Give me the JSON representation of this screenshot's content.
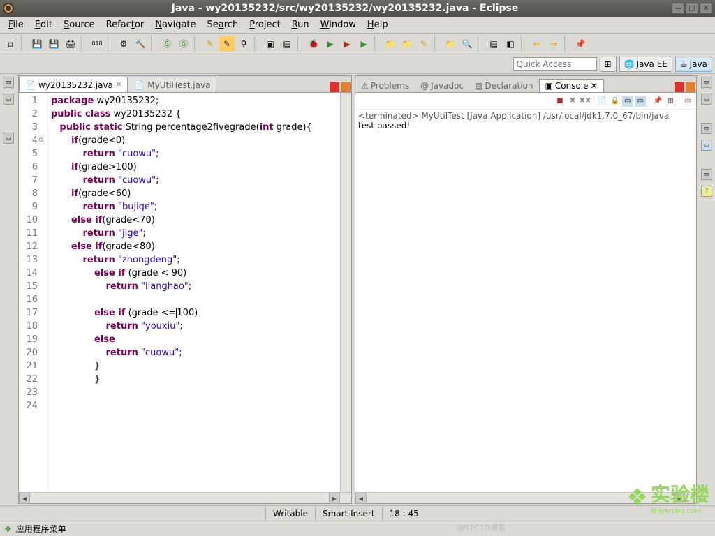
{
  "window": {
    "title": "Java - wy20135232/src/wy20135232/wy20135232.java - Eclipse"
  },
  "menu": [
    "File",
    "Edit",
    "Source",
    "Refactor",
    "Navigate",
    "Search",
    "Project",
    "Run",
    "Window",
    "Help"
  ],
  "quick_access_placeholder": "Quick Access",
  "perspectives": [
    {
      "label": "Java EE",
      "active": false
    },
    {
      "label": "Java",
      "active": true
    }
  ],
  "editor_tabs": [
    {
      "label": "wy20135232.java",
      "active": true,
      "dirty": false
    },
    {
      "label": "MyUtilTest.java",
      "active": false,
      "dirty": false
    }
  ],
  "code": {
    "lines": [
      {
        "n": 1,
        "tokens": [
          [
            "kw",
            "package"
          ],
          [
            "",
            " wy20135232;"
          ]
        ]
      },
      {
        "n": 2,
        "tokens": [
          [
            "",
            ""
          ]
        ]
      },
      {
        "n": 3,
        "tokens": [
          [
            "kw",
            "public class"
          ],
          [
            "",
            " wy20135232 {"
          ]
        ]
      },
      {
        "n": 4,
        "ann": "⊖",
        "tokens": [
          [
            "",
            "   "
          ],
          [
            "kw",
            "public static"
          ],
          [
            "",
            " String percentage2fivegrade("
          ],
          [
            "kw",
            "int"
          ],
          [
            "",
            " grade){"
          ]
        ]
      },
      {
        "n": 5,
        "tokens": [
          [
            "",
            "       "
          ],
          [
            "kw",
            "if"
          ],
          [
            "",
            "(grade<0)"
          ]
        ]
      },
      {
        "n": 6,
        "tokens": [
          [
            "",
            "           "
          ],
          [
            "kw",
            "return"
          ],
          [
            "",
            " "
          ],
          [
            "str",
            "\"cuowu\""
          ],
          [
            "",
            ";"
          ]
        ]
      },
      {
        "n": 7,
        "tokens": [
          [
            "",
            "       "
          ],
          [
            "kw",
            "if"
          ],
          [
            "",
            "(grade>100)"
          ]
        ]
      },
      {
        "n": 8,
        "tokens": [
          [
            "",
            "           "
          ],
          [
            "kw",
            "return"
          ],
          [
            "",
            " "
          ],
          [
            "str",
            "\"cuowu\""
          ],
          [
            "",
            ";"
          ]
        ]
      },
      {
        "n": 9,
        "tokens": [
          [
            "",
            "       "
          ],
          [
            "kw",
            "if"
          ],
          [
            "",
            "(grade<60)"
          ]
        ]
      },
      {
        "n": 10,
        "tokens": [
          [
            "",
            "           "
          ],
          [
            "kw",
            "return"
          ],
          [
            "",
            " "
          ],
          [
            "str",
            "\"bujige\""
          ],
          [
            "",
            ";"
          ]
        ]
      },
      {
        "n": 11,
        "tokens": [
          [
            "",
            "       "
          ],
          [
            "kw",
            "else if"
          ],
          [
            "",
            "(grade<70)"
          ]
        ]
      },
      {
        "n": 12,
        "tokens": [
          [
            "",
            "           "
          ],
          [
            "kw",
            "return"
          ],
          [
            "",
            " "
          ],
          [
            "str",
            "\"jige\""
          ],
          [
            "",
            ";"
          ]
        ]
      },
      {
        "n": 13,
        "tokens": [
          [
            "",
            "       "
          ],
          [
            "kw",
            "else if"
          ],
          [
            "",
            "(grade<80)"
          ]
        ]
      },
      {
        "n": 14,
        "tokens": [
          [
            "",
            "           "
          ],
          [
            "kw",
            "return"
          ],
          [
            "",
            " "
          ],
          [
            "str",
            "\"zhongdeng\""
          ],
          [
            "",
            ";"
          ]
        ]
      },
      {
        "n": 15,
        "tokens": [
          [
            "",
            "               "
          ],
          [
            "kw",
            "else if"
          ],
          [
            "",
            " (grade < 90)"
          ]
        ]
      },
      {
        "n": 16,
        "tokens": [
          [
            "",
            "                   "
          ],
          [
            "kw",
            "return"
          ],
          [
            "",
            " "
          ],
          [
            "str",
            "\"lianghao\""
          ],
          [
            "",
            ";"
          ]
        ]
      },
      {
        "n": 17,
        "tokens": [
          [
            "",
            ""
          ]
        ]
      },
      {
        "n": 18,
        "hl": true,
        "tokens": [
          [
            "",
            "               "
          ],
          [
            "kw",
            "else if"
          ],
          [
            "",
            " (grade <="
          ],
          [
            "caret",
            ""
          ],
          [
            "",
            "100)"
          ]
        ]
      },
      {
        "n": 19,
        "tokens": [
          [
            "",
            "                   "
          ],
          [
            "kw",
            "return"
          ],
          [
            "",
            " "
          ],
          [
            "str",
            "\"youxiu\""
          ],
          [
            "",
            ";"
          ]
        ]
      },
      {
        "n": 20,
        "tokens": [
          [
            "",
            ""
          ]
        ]
      },
      {
        "n": 21,
        "tokens": [
          [
            "",
            "               "
          ],
          [
            "kw",
            "else"
          ]
        ]
      },
      {
        "n": 22,
        "tokens": [
          [
            "",
            "                   "
          ],
          [
            "kw",
            "return"
          ],
          [
            "",
            " "
          ],
          [
            "str",
            "\"cuowu\""
          ],
          [
            "",
            ";"
          ]
        ]
      },
      {
        "n": 23,
        "tokens": [
          [
            "",
            "               }"
          ]
        ]
      },
      {
        "n": 24,
        "tokens": [
          [
            "",
            "               }"
          ]
        ]
      }
    ]
  },
  "views": [
    {
      "label": "Problems",
      "active": false
    },
    {
      "label": "Javadoc",
      "active": false
    },
    {
      "label": "Declaration",
      "active": false
    },
    {
      "label": "Console",
      "active": true
    }
  ],
  "console": {
    "header": "<terminated> MyUtilTest [Java Application] /usr/local/jdk1.7.0_67/bin/java",
    "output": "test passed!"
  },
  "status": {
    "writable": "Writable",
    "insert": "Smart Insert",
    "pos": "18 : 45"
  },
  "taskbar": {
    "app_menu": "应用程序菜单"
  },
  "watermark": {
    "brand": "实验楼",
    "url": "shiyanlou.com"
  },
  "cto": "@51CTO博客"
}
